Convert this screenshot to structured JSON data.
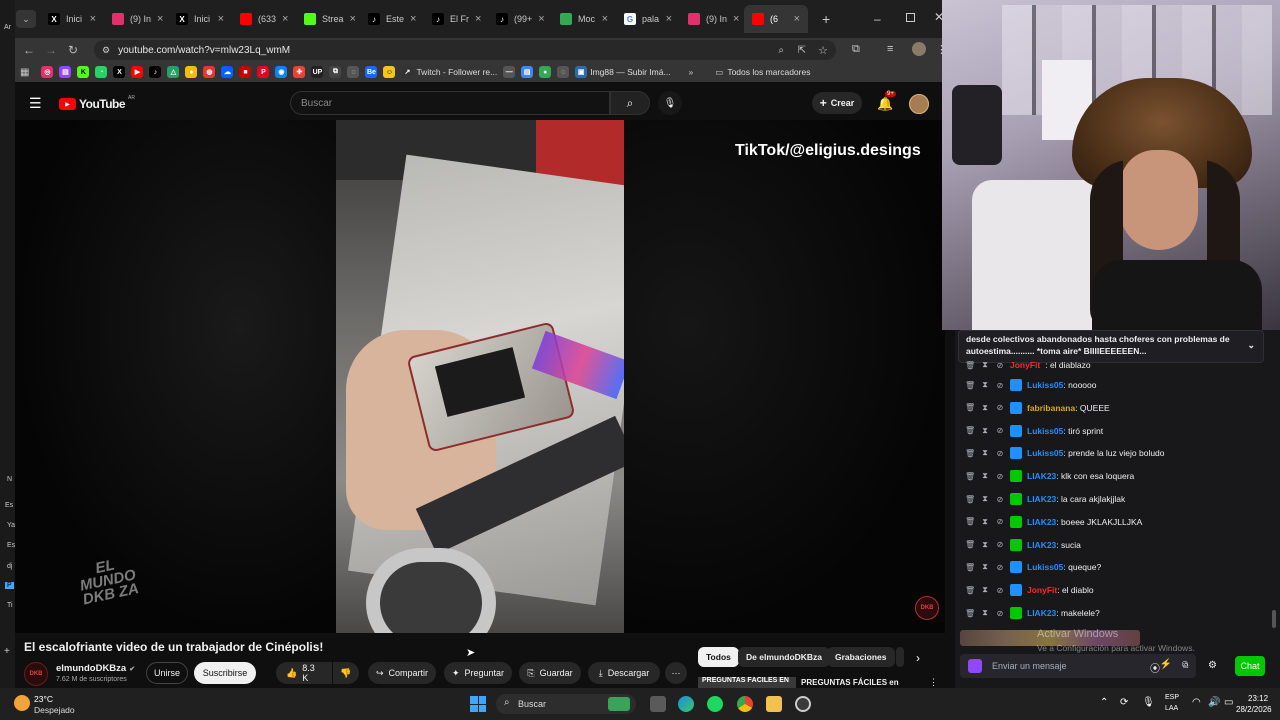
{
  "browser": {
    "tabs": [
      {
        "label": "Inici",
        "icon": "x-logo-icon",
        "color": "#ffffff"
      },
      {
        "label": "(9) In",
        "icon": "instagram-icon",
        "color": "#e1306c"
      },
      {
        "label": "Inici",
        "icon": "x-logo-icon",
        "color": "#ffffff"
      },
      {
        "label": "(633",
        "icon": "youtube-icon",
        "color": "#ff0000"
      },
      {
        "label": "Strea",
        "icon": "kick-icon",
        "color": "#53fc18"
      },
      {
        "label": "Este",
        "icon": "tiktok-icon",
        "color": "#ffffff"
      },
      {
        "label": "El Fr",
        "icon": "tiktok-icon",
        "color": "#ffffff"
      },
      {
        "label": "(99+",
        "icon": "tiktok-icon",
        "color": "#ffffff"
      },
      {
        "label": "Moc",
        "icon": "sheets-icon",
        "color": "#34a853"
      },
      {
        "label": "pala",
        "icon": "google-icon",
        "color": "#4285f4"
      },
      {
        "label": "(9) In",
        "icon": "instagram-icon",
        "color": "#e1306c"
      },
      {
        "label": "(6",
        "icon": "youtube-icon",
        "color": "#ff0000"
      }
    ],
    "url": "youtube.com/watch?v=mlw23Lq_wmM",
    "bookmarks": {
      "twitch_label": "Twitch - Follower re...",
      "imgbb_label": "Img88 — Subir Imá...",
      "folder_label": "Todos los marcadores"
    }
  },
  "youtube": {
    "logo": "YouTube",
    "country": "AR",
    "search_placeholder": "Buscar",
    "create_label": "Crear",
    "notif_count": "9+",
    "overlay_text": "TikTok/@eligius.desings",
    "watermark": "EL MUNDO DKB ZA",
    "channel_mark": "DKB",
    "title": "El escalofriante video de un trabajador de Cinépolis!",
    "channel": {
      "name": "elmundoDKBza",
      "subscribers": "7.62 M de suscriptores",
      "avatar": "DKB"
    },
    "join_label": "Unirse",
    "subscribe_label": "Suscribirse",
    "like_count": "8.3 K",
    "share_label": "Compartir",
    "ask_label": "Preguntar",
    "save_label": "Guardar",
    "download_label": "Descargar",
    "chips": [
      "Todos",
      "De elmundoDKBza",
      "Grabaciones"
    ],
    "next_video_title": "PREGUNTAS FÁCILES en",
    "next_video_thumb": "PREGUNTAS FÁCILES EN"
  },
  "chat": {
    "pinned": "desde colectivos abandonados hasta choferes con problemas de autoestima.......... *toma aire* BIIIIEEEEEEN...",
    "partial_user": "JonyFit",
    "partial_text": ": el diablazo",
    "messages": [
      {
        "user": "Lukiss05",
        "text": ": nooooo",
        "color": "#1e90ff",
        "badge": "#1e90ff"
      },
      {
        "user": "fabribanana",
        "text": ": QUEEE",
        "color": "#daa520",
        "badge": "#1e90ff"
      },
      {
        "user": "Lukiss05",
        "text": ": tiró sprint",
        "color": "#1e90ff",
        "badge": "#1e90ff"
      },
      {
        "user": "Lukiss05",
        "text": ": prende la luz viejo boludo",
        "color": "#1e90ff",
        "badge": "#1e90ff"
      },
      {
        "user": "LIAK23",
        "text": ": klk con esa loquera",
        "color": "#1e90ff",
        "badge": "#00c800"
      },
      {
        "user": "LIAK23",
        "text": ": la cara akjlakjjlak",
        "color": "#1e90ff",
        "badge": "#00c800"
      },
      {
        "user": "LIAK23",
        "text": ": boeee JKLAKJLLJKA",
        "color": "#1e90ff",
        "badge": "#00c800"
      },
      {
        "user": "LIAK23",
        "text": ": sucia",
        "color": "#1e90ff",
        "badge": "#00c800"
      },
      {
        "user": "Lukiss05",
        "text": ": queque?",
        "color": "#1e90ff",
        "badge": "#1e90ff"
      },
      {
        "user": "JonyFit",
        "text": ": el diablo",
        "color": "#ff2828",
        "badge": "#1e90ff"
      },
      {
        "user": "LIAK23",
        "text": ": makelele?",
        "color": "#1e90ff",
        "badge": "#00c800"
      }
    ],
    "activate_windows": "Activar Windows",
    "activate_windows_sub": "Ve a Configuración para activar Windows.",
    "input_placeholder": "Enviar un mensaje",
    "chat_button": "Chat"
  },
  "taskbar": {
    "weather_temp": "23°C",
    "weather_desc": "Despejado",
    "search_label": "Buscar",
    "lang": "ESP",
    "lang_sub": "LAA",
    "time": "23:12",
    "date": "28/2/2026"
  },
  "left_edge": {
    "top": "Ar",
    "labels": [
      "N",
      "Es",
      "Ya",
      "Es",
      "dj",
      "P",
      "Ti"
    ]
  }
}
